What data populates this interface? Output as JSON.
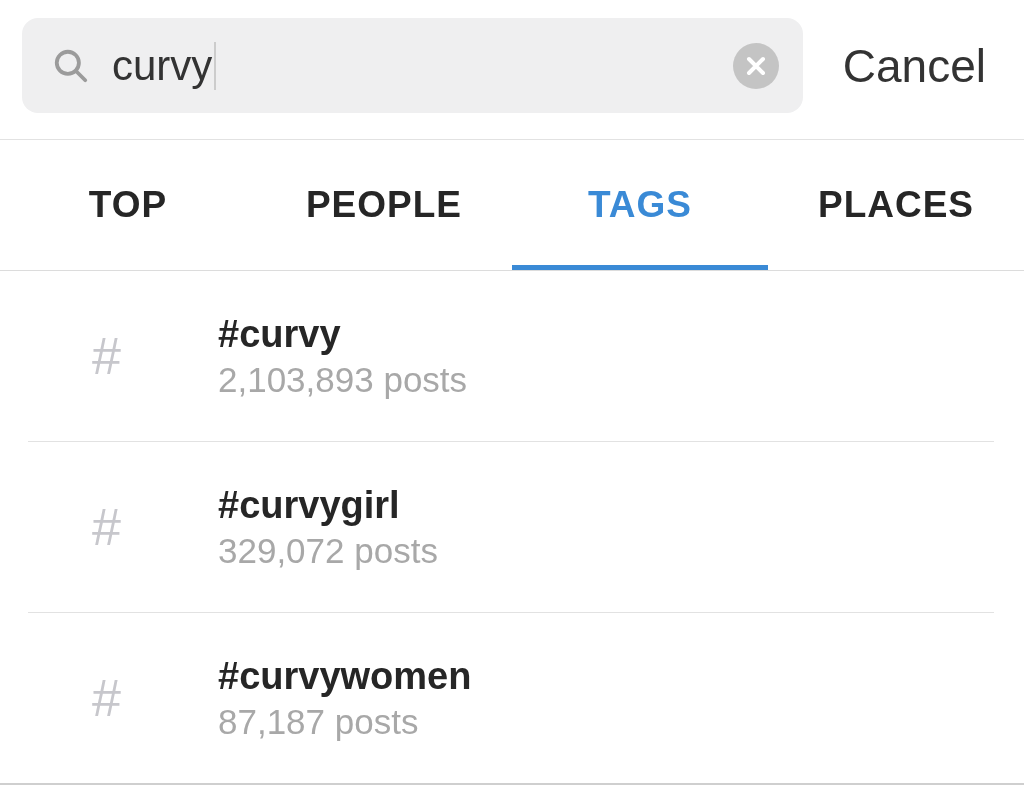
{
  "search": {
    "value": "curvy",
    "cancel": "Cancel"
  },
  "tabs": [
    {
      "label": "TOP",
      "selected": false
    },
    {
      "label": "PEOPLE",
      "selected": false
    },
    {
      "label": "TAGS",
      "selected": true
    },
    {
      "label": "PLACES",
      "selected": false
    }
  ],
  "results": [
    {
      "symbol": "#",
      "tag": "#curvy",
      "count": "2,103,893 posts"
    },
    {
      "symbol": "#",
      "tag": "#curvygirl",
      "count": "329,072 posts"
    },
    {
      "symbol": "#",
      "tag": "#curvywomen",
      "count": "87,187 posts"
    }
  ]
}
